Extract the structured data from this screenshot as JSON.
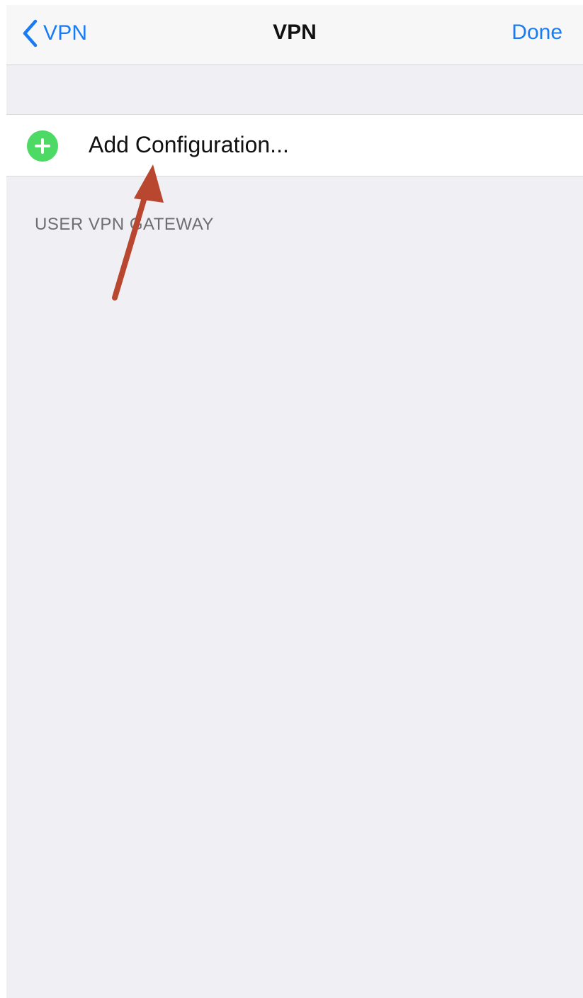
{
  "navbar": {
    "back_label": "VPN",
    "back_icon": "chevron-left-icon",
    "title": "VPN",
    "done_label": "Done"
  },
  "config_list": {
    "add_label": "Add Configuration...",
    "add_icon": "add-circle-icon"
  },
  "section": {
    "header": "USER VPN GATEWAY"
  },
  "colors": {
    "accent": "#1a7cf5",
    "add_icon": "#4cd964",
    "annotation_arrow": "#b9472f",
    "background": "#efeff4"
  }
}
